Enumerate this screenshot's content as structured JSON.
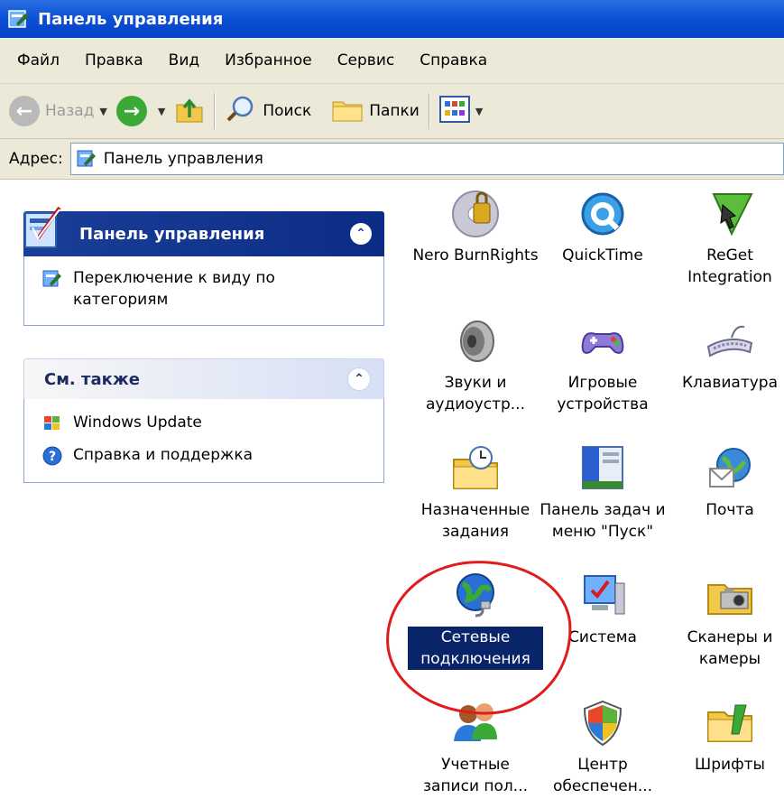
{
  "window": {
    "title": "Панель управления"
  },
  "menu": [
    "Файл",
    "Правка",
    "Вид",
    "Избранное",
    "Сервис",
    "Справка"
  ],
  "toolbar": {
    "back": "Назад",
    "search": "Поиск",
    "folders": "Папки"
  },
  "address": {
    "label": "Адрес:",
    "value": "Панель управления"
  },
  "sidebar": {
    "control_panel": {
      "title": "Панель управления",
      "link": "Переключение к виду по категориям"
    },
    "see_also": {
      "title": "См. также",
      "links": [
        "Windows Update",
        "Справка и поддержка"
      ]
    }
  },
  "items": [
    {
      "label": "Nero BurnRights",
      "icon": "nero-burnrights-icon"
    },
    {
      "label": "QuickTime",
      "icon": "quicktime-icon"
    },
    {
      "label": "ReGet Integration",
      "icon": "reget-icon"
    },
    {
      "label": "Звуки и аудиоустр...",
      "icon": "speaker-icon"
    },
    {
      "label": "Игровые устройства",
      "icon": "gamepad-icon"
    },
    {
      "label": "Клавиатура",
      "icon": "keyboard-icon"
    },
    {
      "label": "Назначенные задания",
      "icon": "scheduled-tasks-icon"
    },
    {
      "label": "Панель задач и меню \"Пуск\"",
      "icon": "taskbar-icon"
    },
    {
      "label": "Почта",
      "icon": "mail-icon"
    },
    {
      "label": "Сетевые подключения",
      "icon": "network-icon",
      "selected": true
    },
    {
      "label": "Система",
      "icon": "system-icon"
    },
    {
      "label": "Сканеры и камеры",
      "icon": "scanner-camera-icon"
    },
    {
      "label": "Учетные записи пол...",
      "icon": "user-accounts-icon"
    },
    {
      "label": "Центр обеспечен...",
      "icon": "security-center-icon"
    },
    {
      "label": "Шрифты",
      "icon": "fonts-folder-icon"
    }
  ],
  "colors": {
    "title_bar": "#0a4fd4",
    "chrome": "#ece9d8",
    "selection": "#0a246a",
    "annotation": "#e01b1b"
  }
}
